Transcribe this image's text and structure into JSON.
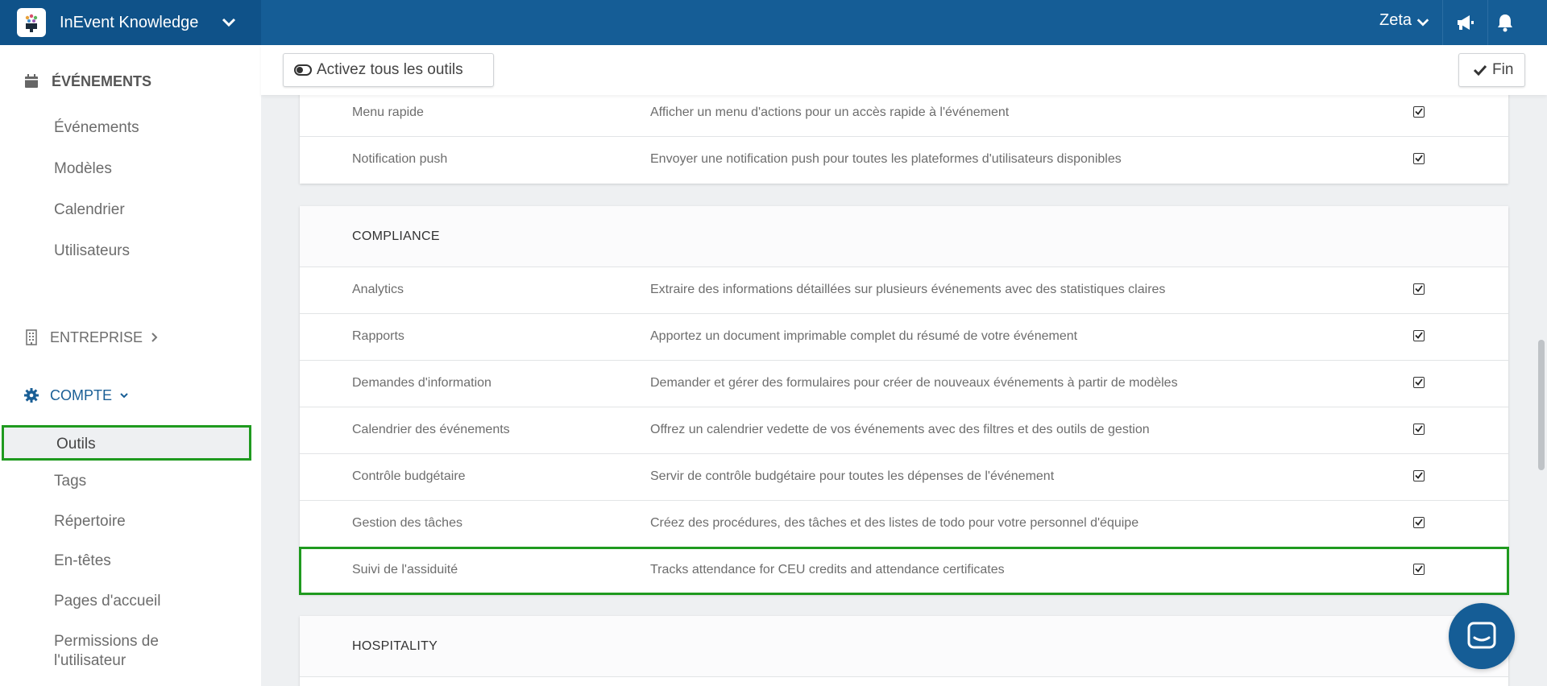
{
  "app": {
    "title": "InEvent Knowledge",
    "user": "Zeta",
    "icons": [
      "app-logo",
      "chevron-down-icon",
      "megaphone-icon",
      "bell-icon"
    ]
  },
  "sidebar": {
    "events_section": "ÉVÉNEMENTS",
    "events_items": [
      "Événements",
      "Modèles",
      "Calendrier",
      "Utilisateurs"
    ],
    "company_section": "ENTREPRISE",
    "account_section": "COMPTE",
    "account_items": [
      "Outils",
      "Tags",
      "Répertoire",
      "En-têtes",
      "Pages d'accueil",
      "Permissions de",
      "l'utilisateur"
    ],
    "active_item": "Outils"
  },
  "actionbar": {
    "enable_all_label": "Activez tous les outils",
    "finish_label": "Fin"
  },
  "tools": {
    "top_rows": [
      {
        "name": "Menu rapide",
        "desc": "Afficher un menu d'actions pour un accès rapide à l'événement",
        "checked": true
      },
      {
        "name": "Notification push",
        "desc": "Envoyer une notification push pour toutes les plateformes d'utilisateurs disponibles",
        "checked": true
      }
    ],
    "compliance": {
      "title": "COMPLIANCE",
      "rows": [
        {
          "name": "Analytics",
          "desc": "Extraire des informations détaillées sur plusieurs événements avec des statistiques claires",
          "checked": true
        },
        {
          "name": "Rapports",
          "desc": "Apportez un document imprimable complet du résumé de votre événement",
          "checked": true
        },
        {
          "name": "Demandes d'information",
          "desc": "Demander et gérer des formulaires pour créer de nouveaux événements à partir de modèles",
          "checked": true
        },
        {
          "name": "Calendrier des événements",
          "desc": "Offrez un calendrier vedette de vos événements avec des filtres et des outils de gestion",
          "checked": true
        },
        {
          "name": "Contrôle budgétaire",
          "desc": "Servir de contrôle budgétaire pour toutes les dépenses de l'événement",
          "checked": true
        },
        {
          "name": "Gestion des tâches",
          "desc": "Créez des procédures, des tâches et des listes de todo pour votre personnel d'équipe",
          "checked": true
        },
        {
          "name": "Suivi de l'assiduité",
          "desc": "Tracks attendance for CEU credits and attendance certificates",
          "checked": true
        }
      ]
    },
    "hospitality": {
      "title": "HOSPITALITY"
    }
  },
  "chat": {
    "icon": "chat-icon"
  },
  "colors": {
    "topbar": "#155d96",
    "brand": "#0f5289",
    "highlight": "#1f9a1f"
  }
}
